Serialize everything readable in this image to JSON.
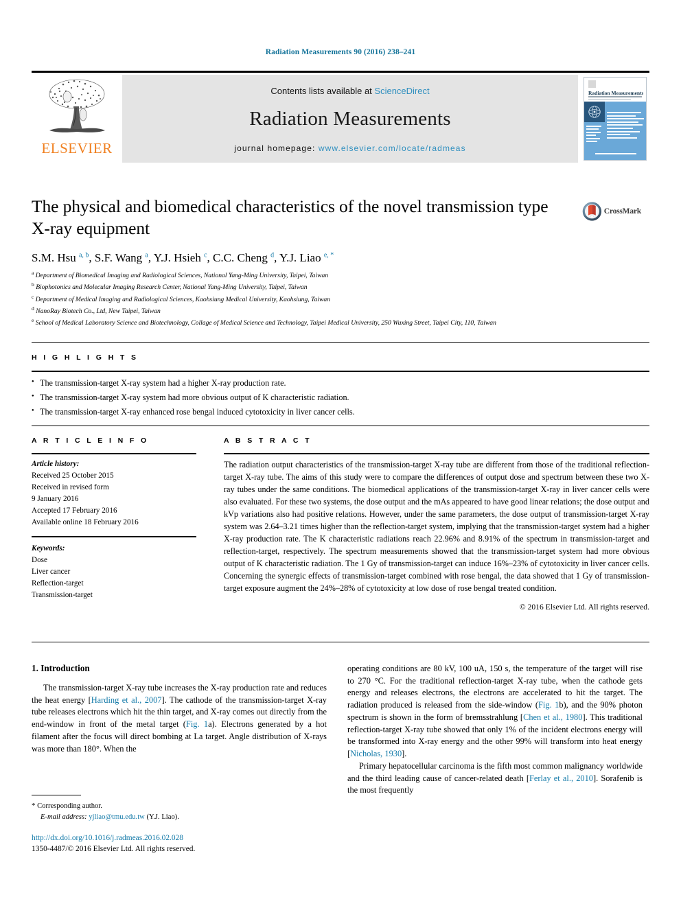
{
  "running_head": "Radiation Measurements 90 (2016) 238–241",
  "masthead": {
    "contents_prefix": "Contents lists available at ",
    "sciencedirect": "ScienceDirect",
    "journal_title": "Radiation Measurements",
    "homepage_prefix": "journal homepage: ",
    "homepage_url": "www.elsevier.com/locate/radmeas",
    "publisher_wordmark": "ELSEVIER",
    "publisher_color": "#f08020",
    "link_color": "#2f8fbf",
    "band_bg": "#e4e4e4",
    "cover": {
      "journal_name": "Radiation Measurements",
      "cover_accent": "#6aa8d8",
      "cover_dark": "#27557c"
    }
  },
  "article": {
    "title": "The physical and biomedical characteristics of the novel transmission type X-ray equipment",
    "crossmark_label": "CrossMark",
    "authors_html": "S.M. Hsu <sup>a, b</sup>, S.F. Wang <sup>a</sup>, Y.J. Hsieh <sup>c</sup>, C.C. Cheng <sup>d</sup>, Y.J. Liao <sup>e, *</sup>",
    "affiliations": [
      {
        "marker": "a",
        "text": "Department of Biomedical Imaging and Radiological Sciences, National Yang-Ming University, Taipei, Taiwan"
      },
      {
        "marker": "b",
        "text": "Biophotonics and Molecular Imaging Research Center, National Yang-Ming University, Taipei, Taiwan"
      },
      {
        "marker": "c",
        "text": "Department of Medical Imaging and Radiological Sciences, Kaohsiung Medical University, Kaohsiung, Taiwan"
      },
      {
        "marker": "d",
        "text": "NanoRay Biotech Co., Ltd, New Taipei, Taiwan"
      },
      {
        "marker": "e",
        "text": "School of Medical Laboratory Science and Biotechnology, Collage of Medical Science and Technology, Taipei Medical University, 250 Wuxing Street, Taipei City, 110, Taiwan"
      }
    ]
  },
  "highlights": {
    "heading": "H I G H L I G H T S",
    "items": [
      "The transmission-target X-ray system had a higher X-ray production rate.",
      "The transmission-target X-ray system had more obvious output of K characteristic radiation.",
      "The transmission-target X-ray enhanced rose bengal induced cytotoxicity in liver cancer cells."
    ]
  },
  "article_info": {
    "heading": "A R T I C L E   I N F O",
    "history_label": "Article history:",
    "history_lines": [
      "Received 25 October 2015",
      "Received in revised form",
      "9 January 2016",
      "Accepted 17 February 2016",
      "Available online 18 February 2016"
    ],
    "keywords_label": "Keywords:",
    "keywords": [
      "Dose",
      "Liver cancer",
      "Reflection-target",
      "Transmission-target"
    ]
  },
  "abstract": {
    "heading": "A B S T R A C T",
    "text": "The radiation output characteristics of the transmission-target X-ray tube are different from those of the traditional reflection-target X-ray tube. The aims of this study were to compare the differences of output dose and spectrum between these two X-ray tubes under the same conditions. The biomedical applications of the transmission-target X-ray in liver cancer cells were also evaluated. For these two systems, the dose output and the mAs appeared to have good linear relations; the dose output and kVp variations also had positive relations. However, under the same parameters, the dose output of transmission-target X-ray system was 2.64–3.21 times higher than the reflection-target system, implying that the transmission-target system had a higher X-ray production rate. The K characteristic radiations reach 22.96% and 8.91% of the spectrum in transmission-target and reflection-target, respectively. The spectrum measurements showed that the transmission-target system had more obvious output of K characteristic radiation. The 1 Gy of transmission-target can induce 16%–23% of cytotoxicity in liver cancer cells. Concerning the synergic effects of transmission-target combined with rose bengal, the data showed that 1 Gy of transmission-target exposure augment the 24%–28% of cytotoxicity at low dose of rose bengal treated condition.",
    "copyright": "© 2016 Elsevier Ltd. All rights reserved."
  },
  "body": {
    "section_number_title": "1.  Introduction",
    "left_paragraph_html": "The transmission-target X-ray tube increases the X-ray production rate and reduces the heat energy [<span class=\"ref\">Harding et al., 2007</span>]. The cathode of the transmission-target X-ray tube releases electrons which hit the thin target, and X-ray comes out directly from the end-window in front of the metal target (<span class=\"ref\">Fig. 1</span>a). Electrons generated by a hot filament after the focus will direct bombing at La target. Angle distribution of X-rays was more than 180°. When the",
    "right_paragraph_1_html": "operating conditions are 80 kV, 100 uA, 150 s, the temperature of the target will rise to 270 °C. For the traditional reflection-target X-ray tube, when the cathode gets energy and releases electrons, the electrons are accelerated to hit the target. The radiation produced is released from the side-window (<span class=\"ref\">Fig. 1</span>b), and the 90% photon spectrum is shown in the form of bremsstrahlung [<span class=\"ref\">Chen et al., 1980</span>]. This traditional reflection-target X-ray tube showed that only 1% of the incident electrons energy will be transformed into X-ray energy and the other 99% will transform into heat energy [<span class=\"ref\">Nicholas, 1930</span>].",
    "right_paragraph_2_html": "Primary hepatocellular carcinoma is the fifth most common malignancy worldwide and the third leading cause of cancer-related death [<span class=\"ref\">Ferlay et al., 2010</span>]. Sorafenib is the most frequently"
  },
  "footnote": {
    "corresponding_author": "Corresponding author.",
    "email_label": "E-mail address:",
    "email": "yjliao@tmu.edu.tw",
    "email_owner": "(Y.J. Liao)."
  },
  "footer": {
    "doi": "http://dx.doi.org/10.1016/j.radmeas.2016.02.028",
    "issn_copyright": "1350-4487/© 2016 Elsevier Ltd. All rights reserved."
  }
}
